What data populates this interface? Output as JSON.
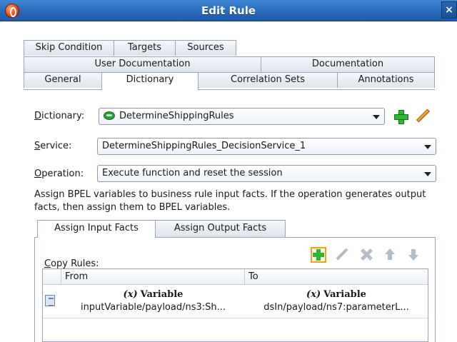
{
  "window": {
    "title": "Edit Rule",
    "close_glyph": "×"
  },
  "tabs": {
    "row1": [
      "Skip Condition",
      "Targets",
      "Sources"
    ],
    "row2": [
      "User Documentation",
      "Documentation"
    ],
    "row3": [
      "General",
      "Dictionary",
      "Correlation Sets",
      "Annotations"
    ],
    "active": "Dictionary"
  },
  "form": {
    "dictionary": {
      "label_first": "D",
      "label_rest": "ictionary:",
      "value": "DetermineShippingRules"
    },
    "service": {
      "label_first": "S",
      "label_rest": "ervice:",
      "value": "DetermineShippingRules_DecisionService_1"
    },
    "operation": {
      "label_first": "O",
      "label_rest": "peration:",
      "value": "Execute function and reset the session"
    }
  },
  "description": "Assign BPEL variables to business rule input facts. If the operation generates output facts, then assign them to BPEL variables.",
  "subtabs": [
    "Assign Input Facts",
    "Assign Output Facts"
  ],
  "copy_rules": {
    "label_first": "C",
    "label_rest": "opy Rules:",
    "columns": [
      "From",
      "To"
    ],
    "rows": [
      {
        "from_type": "Variable",
        "from_path": "inputVariable/payload/ns3:Sh...",
        "to_type": "Variable",
        "to_path": "dsIn/payload/ns7:parameterL..."
      }
    ],
    "var_glyph": "(x)"
  },
  "colors": {
    "title_bar": "#2d6fbf",
    "accent_green": "#2fb534",
    "highlight_orange": "#f0a21a"
  }
}
